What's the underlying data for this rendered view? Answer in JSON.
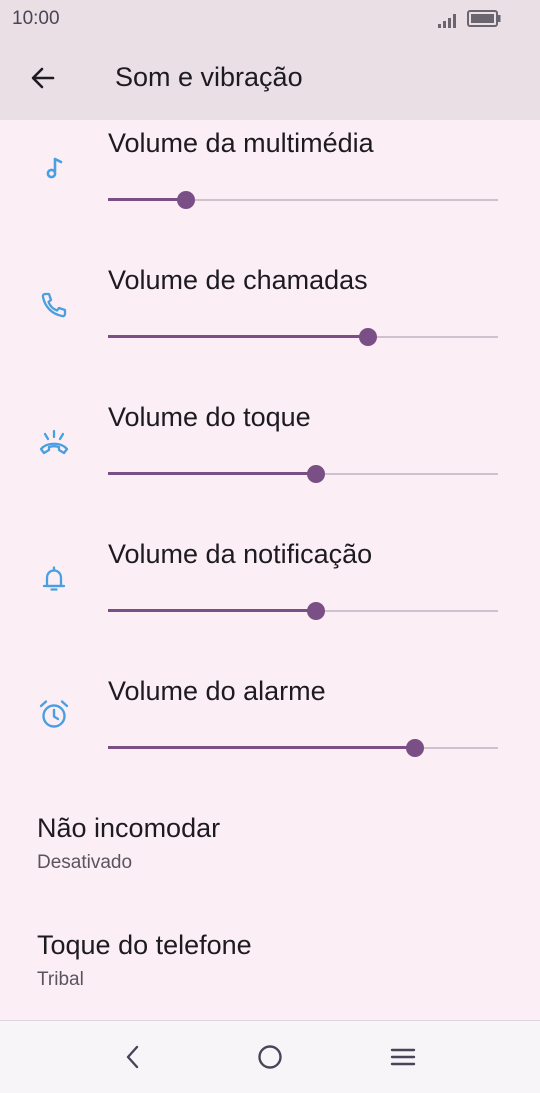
{
  "status": {
    "time": "10:00"
  },
  "appbar": {
    "title": "Som e vibração"
  },
  "volumes": [
    {
      "label": "Volume da multimédia",
      "icon": "music-note-icon",
      "level": 0.2
    },
    {
      "label": "Volume de chamadas",
      "icon": "phone-icon",
      "level": 0.667
    },
    {
      "label": "Volume do toque",
      "icon": "ringing-phone-icon",
      "level": 0.533
    },
    {
      "label": "Volume da notificação",
      "icon": "bell-icon",
      "level": 0.533
    },
    {
      "label": "Volume do alarme",
      "icon": "alarm-clock-icon",
      "level": 0.787
    }
  ],
  "prefs": [
    {
      "title": "Não incomodar",
      "summary": "Desativado"
    },
    {
      "title": "Toque do telefone",
      "summary": "Tribal"
    }
  ],
  "colors": {
    "accent": "#7a4f86",
    "icon": "#4a9fe0",
    "track": "#cdc3ce"
  }
}
